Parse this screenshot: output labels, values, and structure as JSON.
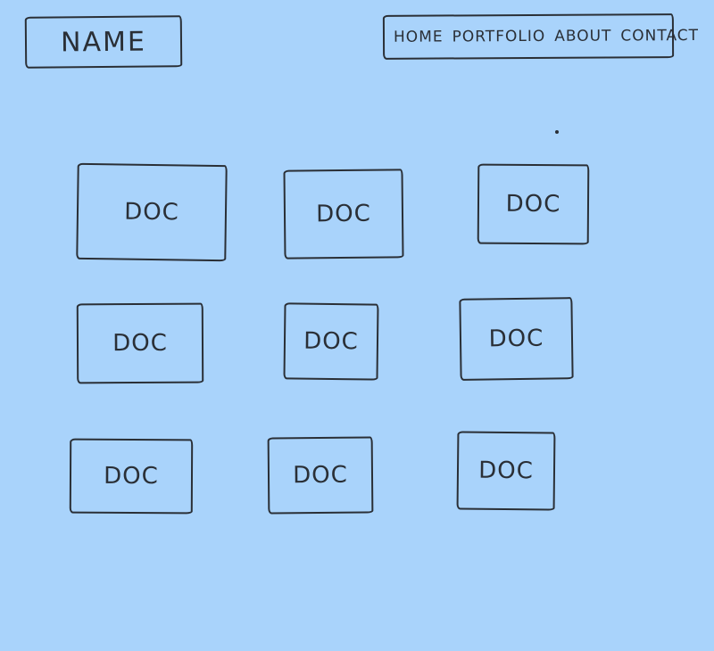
{
  "header": {
    "name": "NAME",
    "nav": {
      "home": "HOME",
      "portfolio": "PORTFOLIO",
      "about": "ABOUT",
      "contact": "CONTACT"
    }
  },
  "docs": [
    {
      "label": "DOC"
    },
    {
      "label": "DOC"
    },
    {
      "label": "DOC"
    },
    {
      "label": "DOC"
    },
    {
      "label": "DOC"
    },
    {
      "label": "DOC"
    },
    {
      "label": "DOC"
    },
    {
      "label": "DOC"
    },
    {
      "label": "DOC"
    }
  ],
  "colors": {
    "background": "#a9d3fb",
    "ink": "#2a2f36"
  }
}
